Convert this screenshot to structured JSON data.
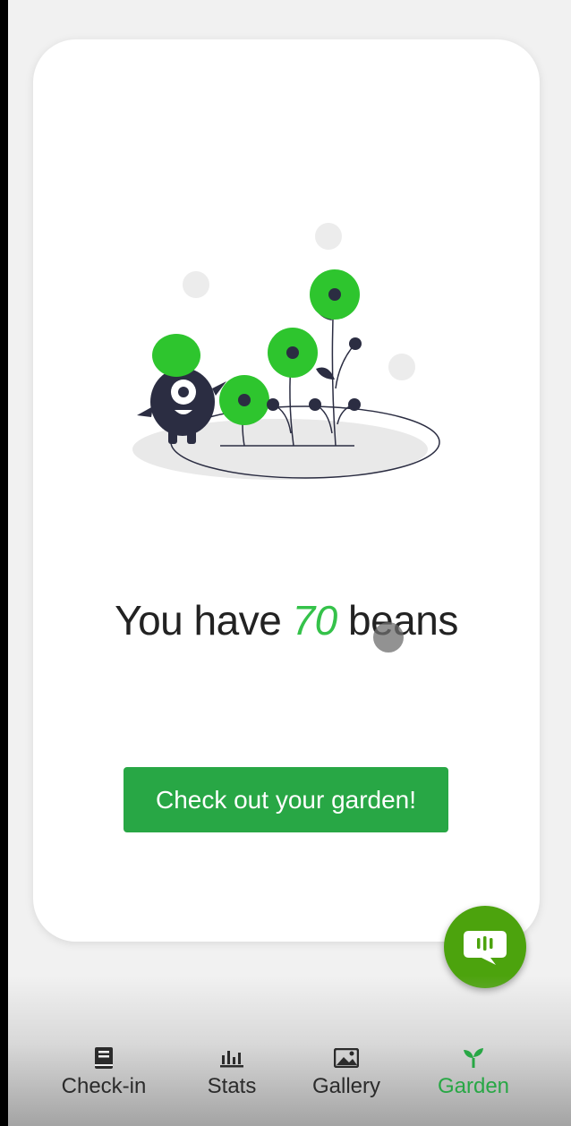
{
  "beans": {
    "prefix": "You have",
    "count": "70",
    "suffix": "beans"
  },
  "cta_label": "Check out your garden!",
  "fab": {
    "icon": "chat-bubble-icon"
  },
  "nav": {
    "items": [
      {
        "label": "Check-in",
        "icon": "book-icon",
        "active": false
      },
      {
        "label": "Stats",
        "icon": "bar-chart-icon",
        "active": false
      },
      {
        "label": "Gallery",
        "icon": "image-icon",
        "active": false
      },
      {
        "label": "Garden",
        "icon": "sprout-icon",
        "active": true
      }
    ]
  },
  "colors": {
    "accent": "#28a745",
    "count": "#35c24a",
    "fab": "#4ca30d",
    "illustration_green": "#2ec52e",
    "illustration_dark": "#2b2d42"
  }
}
